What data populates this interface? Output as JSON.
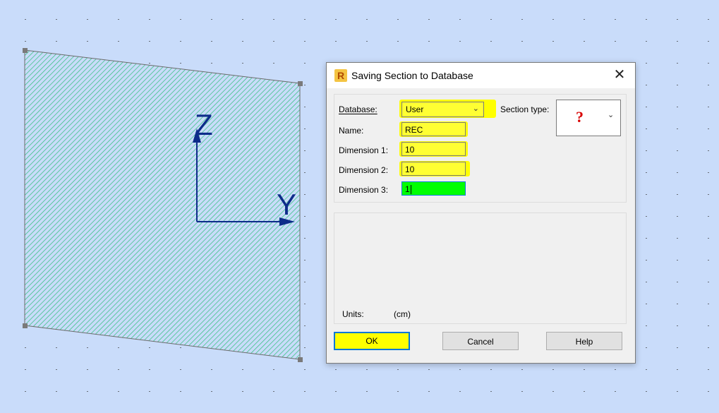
{
  "canvas": {
    "axis_z_label": "Z",
    "axis_y_label": "Y",
    "hatch_color": "#2fbf7a",
    "axis_color": "#0d2c8a"
  },
  "dialog": {
    "title": "Saving Section to Database",
    "close_glyph": "✕",
    "app_icon_letter": "R",
    "database_label": "Database:",
    "database_value": "User",
    "section_type_label": "Section type:",
    "section_type_value": "?",
    "name_label": "Name:",
    "name_value": "REC",
    "dimension1_label": "Dimension 1:",
    "dimension1_value": "10",
    "dimension2_label": "Dimension 2:",
    "dimension2_value": "10",
    "dimension3_label": "Dimension 3:",
    "dimension3_value": "1",
    "units_label": "Units:",
    "units_value": "(cm)",
    "ok_label": "OK",
    "cancel_label": "Cancel",
    "help_label": "Help",
    "highlight_color": "#ffff00",
    "active_field_color": "#00ff00"
  }
}
